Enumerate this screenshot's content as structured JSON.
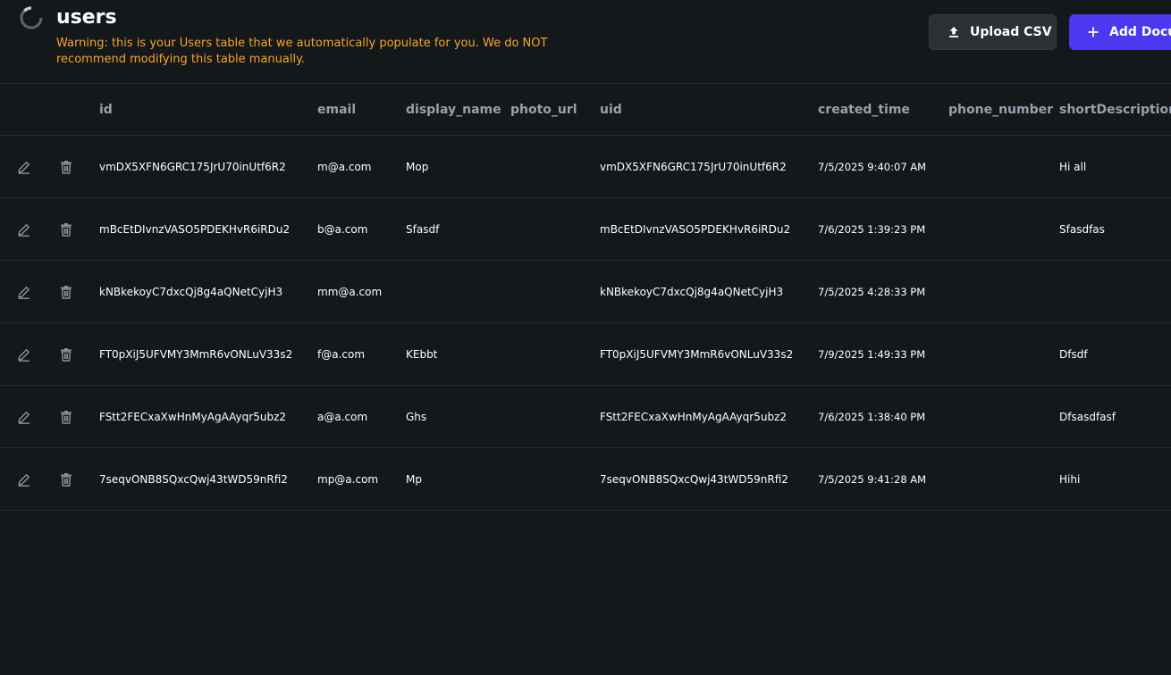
{
  "header": {
    "title": "users",
    "warning": "Warning: this is your Users table that we automatically populate for you. We do NOT recommend modifying this table manually.",
    "upload_label": "Upload CSV",
    "add_label": "Add Docu",
    "icons": {
      "loading": "loading-spinner-icon",
      "upload": "upload-icon",
      "add": "plus-icon"
    },
    "colors": {
      "warning": "#f5a623",
      "add_button": "#4b39ef",
      "upload_button": "#2a3035"
    }
  },
  "table": {
    "columns": [
      "id",
      "email",
      "display_name",
      "photo_url",
      "uid",
      "created_time",
      "phone_number",
      "shortDescription"
    ],
    "row_icons": {
      "edit": "edit-icon",
      "delete": "trash-icon"
    },
    "rows": [
      {
        "id": "vmDX5XFN6GRC175JrU70inUtf6R2",
        "email": "m@a.com",
        "display_name": "Mop",
        "photo_url": "",
        "uid": "vmDX5XFN6GRC175JrU70inUtf6R2",
        "created_time": "7/5/2025 9:40:07 AM",
        "phone_number": "",
        "shortDescription": "Hi all"
      },
      {
        "id": "mBcEtDIvnzVASO5PDEKHvR6iRDu2",
        "email": "b@a.com",
        "display_name": "Sfasdf",
        "photo_url": "",
        "uid": "mBcEtDIvnzVASO5PDEKHvR6iRDu2",
        "created_time": "7/6/2025 1:39:23 PM",
        "phone_number": "",
        "shortDescription": "Sfasdfas"
      },
      {
        "id": "kNBkekoyC7dxcQj8g4aQNetCyjH3",
        "email": "mm@a.com",
        "display_name": "",
        "photo_url": "",
        "uid": "kNBkekoyC7dxcQj8g4aQNetCyjH3",
        "created_time": "7/5/2025 4:28:33 PM",
        "phone_number": "",
        "shortDescription": ""
      },
      {
        "id": "FT0pXiJ5UFVMY3MmR6vONLuV33s2",
        "email": "f@a.com",
        "display_name": "KEbbt",
        "photo_url": "",
        "uid": "FT0pXiJ5UFVMY3MmR6vONLuV33s2",
        "created_time": "7/9/2025 1:49:33 PM",
        "phone_number": "",
        "shortDescription": "Dfsdf"
      },
      {
        "id": "FStt2FECxaXwHnMyAgAAyqr5ubz2",
        "email": "a@a.com",
        "display_name": "Ghs",
        "photo_url": "",
        "uid": "FStt2FECxaXwHnMyAgAAyqr5ubz2",
        "created_time": "7/6/2025 1:38:40 PM",
        "phone_number": "",
        "shortDescription": "Dfsasdfasf"
      },
      {
        "id": "7seqvONB8SQxcQwj43tWD59nRfi2",
        "email": "mp@a.com",
        "display_name": "Mp",
        "photo_url": "",
        "uid": "7seqvONB8SQxcQwj43tWD59nRfi2",
        "created_time": "7/5/2025 9:41:28 AM",
        "phone_number": "",
        "shortDescription": "Hihi"
      }
    ]
  }
}
